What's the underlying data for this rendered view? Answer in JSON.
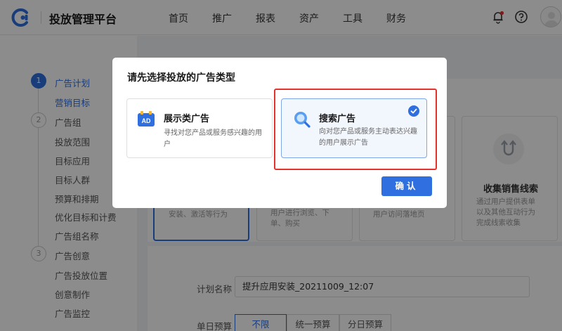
{
  "header": {
    "app_title": "投放管理平台",
    "nav": [
      "首页",
      "推广",
      "报表",
      "资产",
      "工具",
      "财务"
    ],
    "icons": [
      "bell-icon",
      "help-icon",
      "avatar"
    ]
  },
  "sidebar": {
    "steps": [
      {
        "num": "1",
        "label": "广告计划",
        "subitems": [
          "营销目标"
        ]
      },
      {
        "num": "2",
        "label": "广告组",
        "subitems": [
          "投放范围",
          "目标应用",
          "目标人群",
          "预算和排期",
          "优化目标和计费",
          "广告组名称"
        ]
      },
      {
        "num": "3",
        "label": "广告创意",
        "subitems": [
          "广告投放位置",
          "创意制作",
          "广告监控"
        ]
      }
    ]
  },
  "background": {
    "card_texts": {
      "card1": "安装、激活等行为",
      "card2": [
        "用户进行浏览、下",
        "单、购买"
      ],
      "card3": "用户访问落地页",
      "card4_title": "收集销售线索",
      "card4_desc": [
        "通过用户提供表单",
        "以及其他互动行为",
        "完成线索收集"
      ]
    },
    "form": {
      "plan_name_label": "计划名称",
      "plan_name_value": "提升应用安装_20211009_12:07",
      "budget_label": "单日预算",
      "budget_options": [
        "不限",
        "统一预算",
        "分日预算"
      ],
      "budget_selected": "不限"
    }
  },
  "modal": {
    "title": "请先选择投放的广告类型",
    "options": [
      {
        "title": "展示类广告",
        "desc": [
          "寻找对您产品或服务感兴趣的用",
          "户"
        ],
        "icon": "ad-icon",
        "selected": false
      },
      {
        "title": "搜索广告",
        "desc": [
          "向对您产品或服务主动表达兴趣",
          "的用户展示广告"
        ],
        "icon": "search-icon",
        "selected": true
      }
    ],
    "confirm_label": "确认"
  },
  "colors": {
    "primary": "#2f6fdf",
    "highlight_border": "#e5322d",
    "overlay": "rgba(0,0,0,0.45)"
  }
}
